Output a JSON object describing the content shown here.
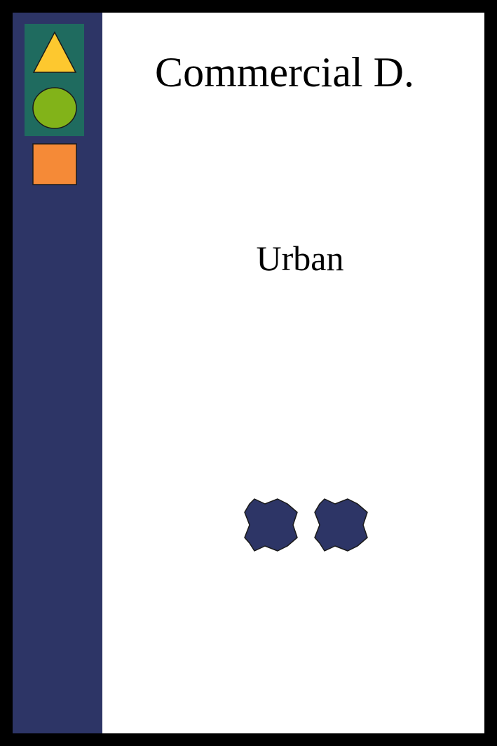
{
  "card": {
    "title": "Commercial D.",
    "category": "Urban"
  },
  "sidebar": {
    "icons": [
      "triangle-icon",
      "circle-icon",
      "square-icon"
    ],
    "colors": {
      "background": "#2d3566",
      "group_background": "#1f6b5f",
      "triangle": "#fdc82f",
      "circle": "#82b319",
      "square": "#f58a37"
    }
  },
  "cost": {
    "count": 2,
    "icon": "cross-token-icon",
    "color": "#2d3566"
  }
}
